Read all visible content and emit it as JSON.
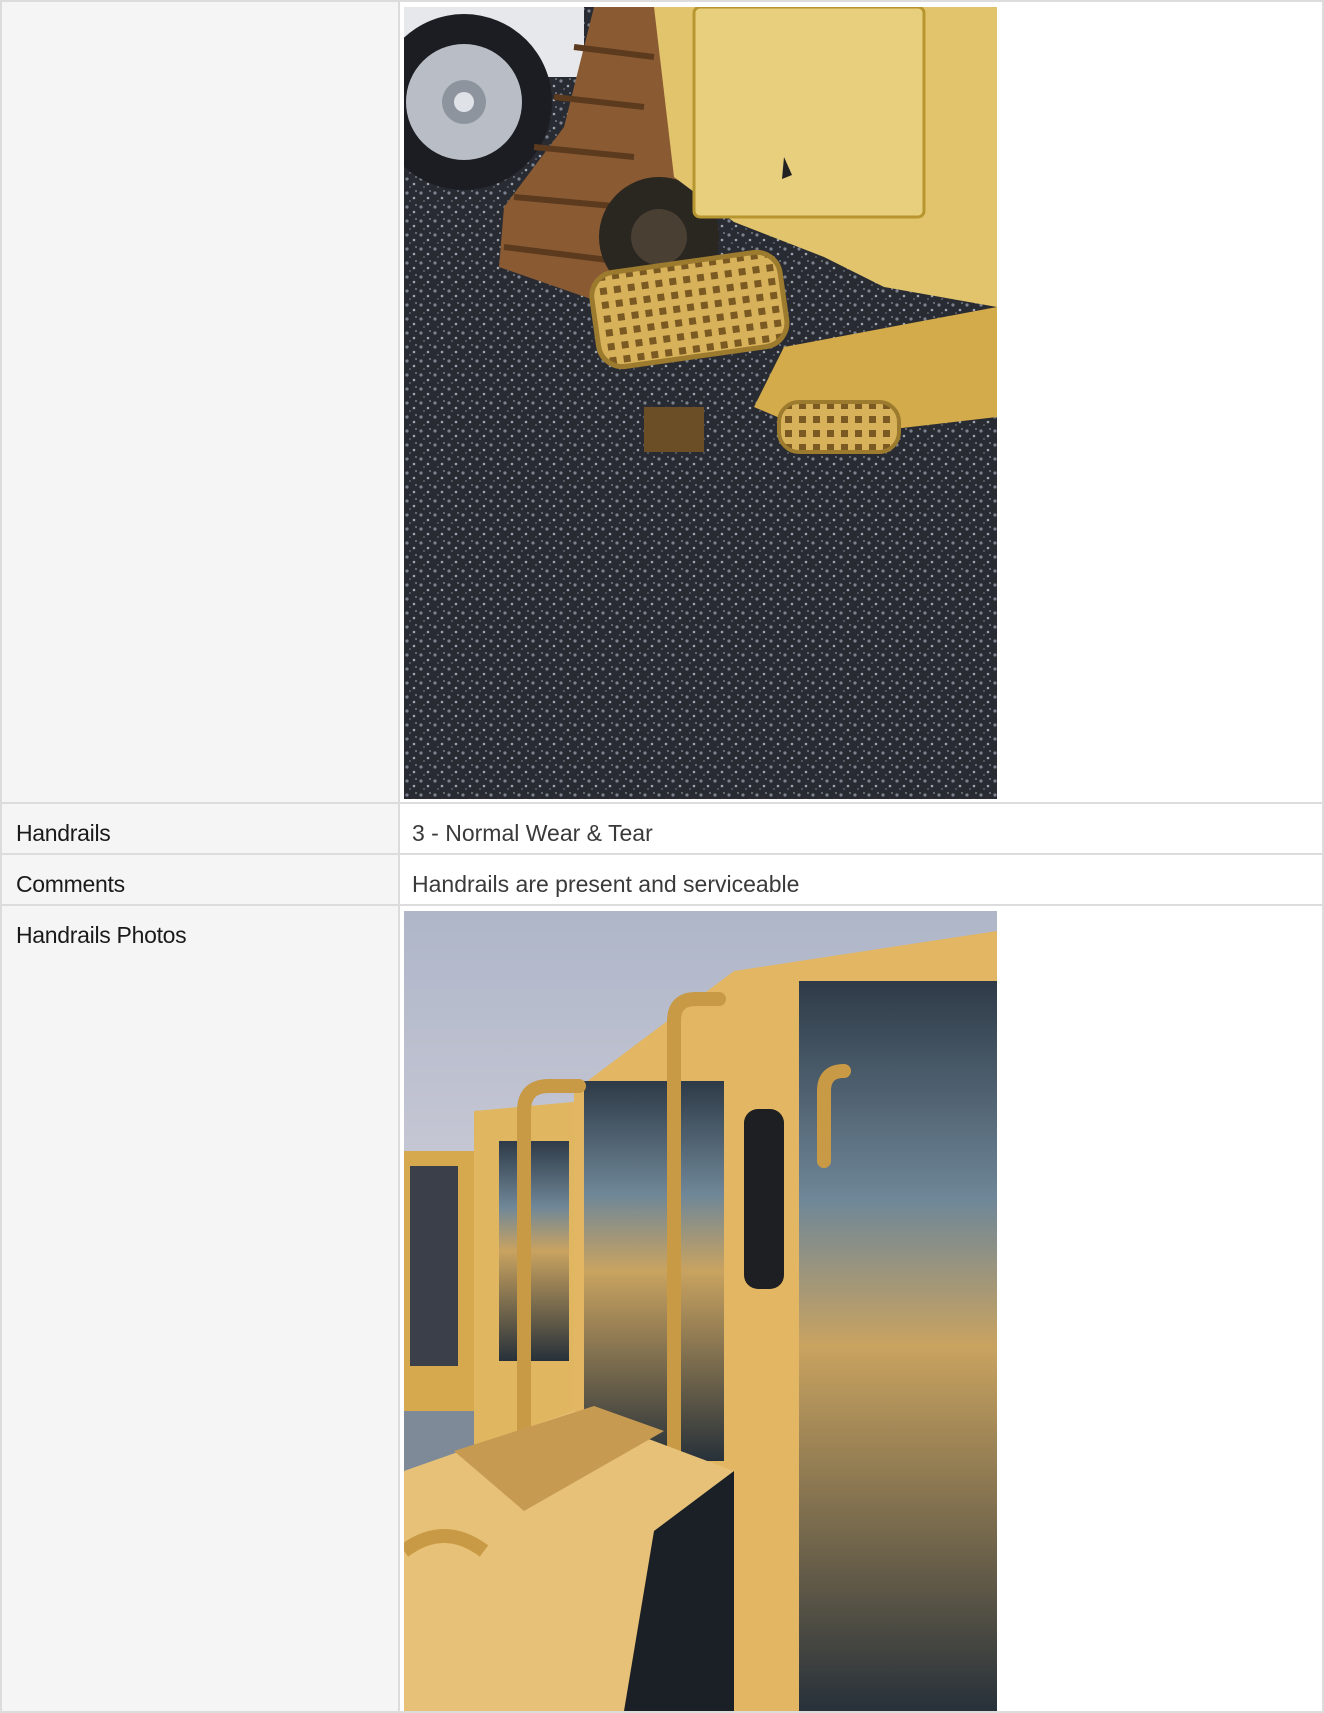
{
  "rows": [
    {
      "label": "",
      "type": "photo",
      "photo_subject": "steps-photo"
    },
    {
      "label": "Handrails",
      "type": "text",
      "value": "3 - Normal Wear & Tear"
    },
    {
      "label": "Comments",
      "type": "text",
      "value": "Handrails are present and serviceable"
    },
    {
      "label": "Handrails Photos",
      "type": "photo",
      "photo_subject": "handrails-photo"
    }
  ],
  "colors": {
    "label_bg": "#f5f5f5",
    "border": "#dcdcdc",
    "machine_yellow": "#d9b35a"
  }
}
